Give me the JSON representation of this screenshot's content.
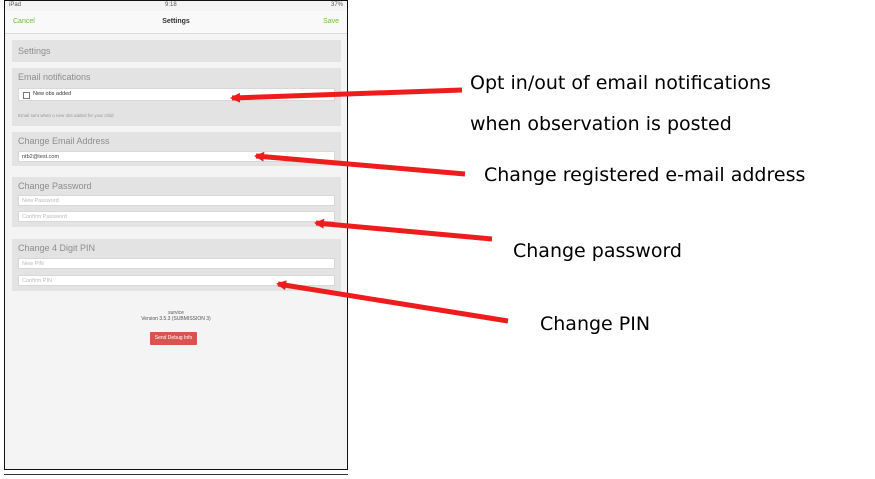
{
  "status_bar": {
    "carrier": "iPad",
    "time": "9:18",
    "battery": "37%"
  },
  "nav": {
    "cancel": "Cancel",
    "title": "Settings",
    "save": "Save"
  },
  "sections": {
    "settings": {
      "title": "Settings"
    },
    "email_notifications": {
      "title": "Email notifications",
      "checkbox_label": "New obs added",
      "checked": false,
      "hint": "Email sent when a new obs added for your child"
    },
    "change_email": {
      "title": "Change Email Address",
      "value": "ntb2@test.com"
    },
    "change_password": {
      "title": "Change Password",
      "new_placeholder": "New Password",
      "confirm_placeholder": "Confirm Password"
    },
    "change_pin": {
      "title": "Change 4 Digit PIN",
      "new_placeholder": "New PIN",
      "confirm_placeholder": "Confirm PIN"
    }
  },
  "footer": {
    "app_name": "survice",
    "version": "Version 3.5.3 (SUBMISSION 3)",
    "debug_button": "Send Debug Info"
  },
  "annotations": {
    "email_notifications_line1": "Opt in/out of email notifications",
    "email_notifications_line2": "when observation is posted",
    "email_address": "Change registered e-mail address",
    "password": "Change password",
    "pin": "Change PIN"
  },
  "colors": {
    "accent": "#6cbf3a",
    "arrow": "#ee1c1c",
    "debug_button": "#d9534f"
  }
}
